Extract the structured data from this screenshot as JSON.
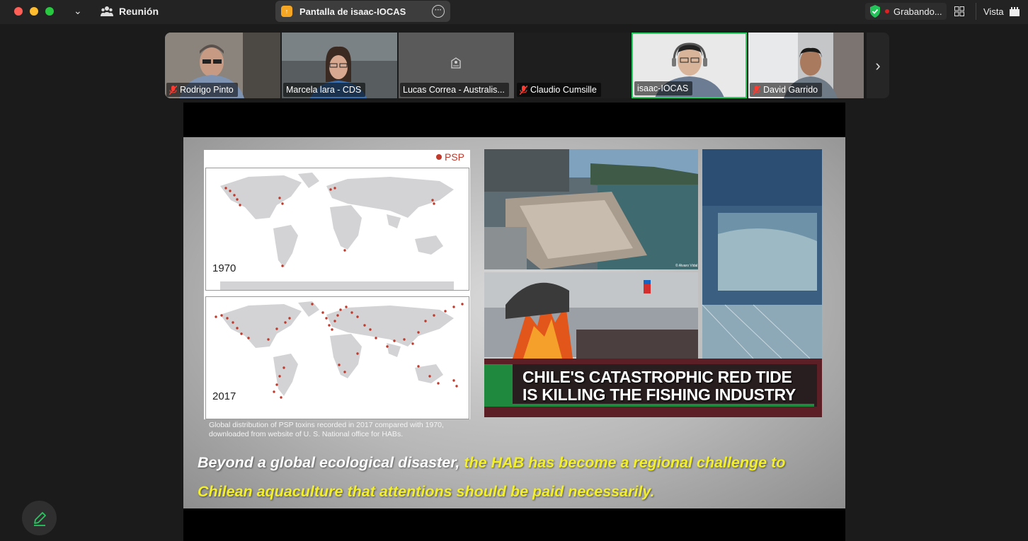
{
  "window": {
    "meeting_title": "Reunión",
    "share_title": "Pantalla de isaac-IOCAS",
    "recording_label": "Grabando...",
    "view_label": "Vista"
  },
  "participants": [
    {
      "name": "Rodrigo Pinto",
      "muted": true
    },
    {
      "name": "Marcela lara - CDS",
      "muted": false
    },
    {
      "name": "Lucas Correa - Australis...",
      "muted": false
    },
    {
      "name": "Claudio Cumsille",
      "muted": true
    },
    {
      "name": "isaac-IOCAS",
      "muted": false,
      "active_speaker": true
    },
    {
      "name": "David Garrido",
      "muted": true
    }
  ],
  "slide": {
    "legend_label": "PSP",
    "map_year_top": "1970",
    "map_year_bottom": "2017",
    "caption_line1": "Global distribution of PSP toxins recorded in 2017 compared with 1970,",
    "caption_line2": "downloaded from website of U. S. National office for HABs.",
    "headline_line1": "CHILE'S CATASTROPHIC RED TIDE",
    "headline_line2": "IS KILLING THE FISHING INDUSTRY",
    "photo_credit": "© Alvaro Vidal",
    "text_white": "Beyond a global ecological disaster,",
    "text_yellow": " the HAB has become a  regional challenge to Chilean aquaculture that attentions should be paid necessarily.",
    "accent_yellow": "#f3ef2a",
    "psp_color": "#c0392b"
  },
  "colors": {
    "active_border": "#23d160",
    "record_dot": "#e02020"
  }
}
